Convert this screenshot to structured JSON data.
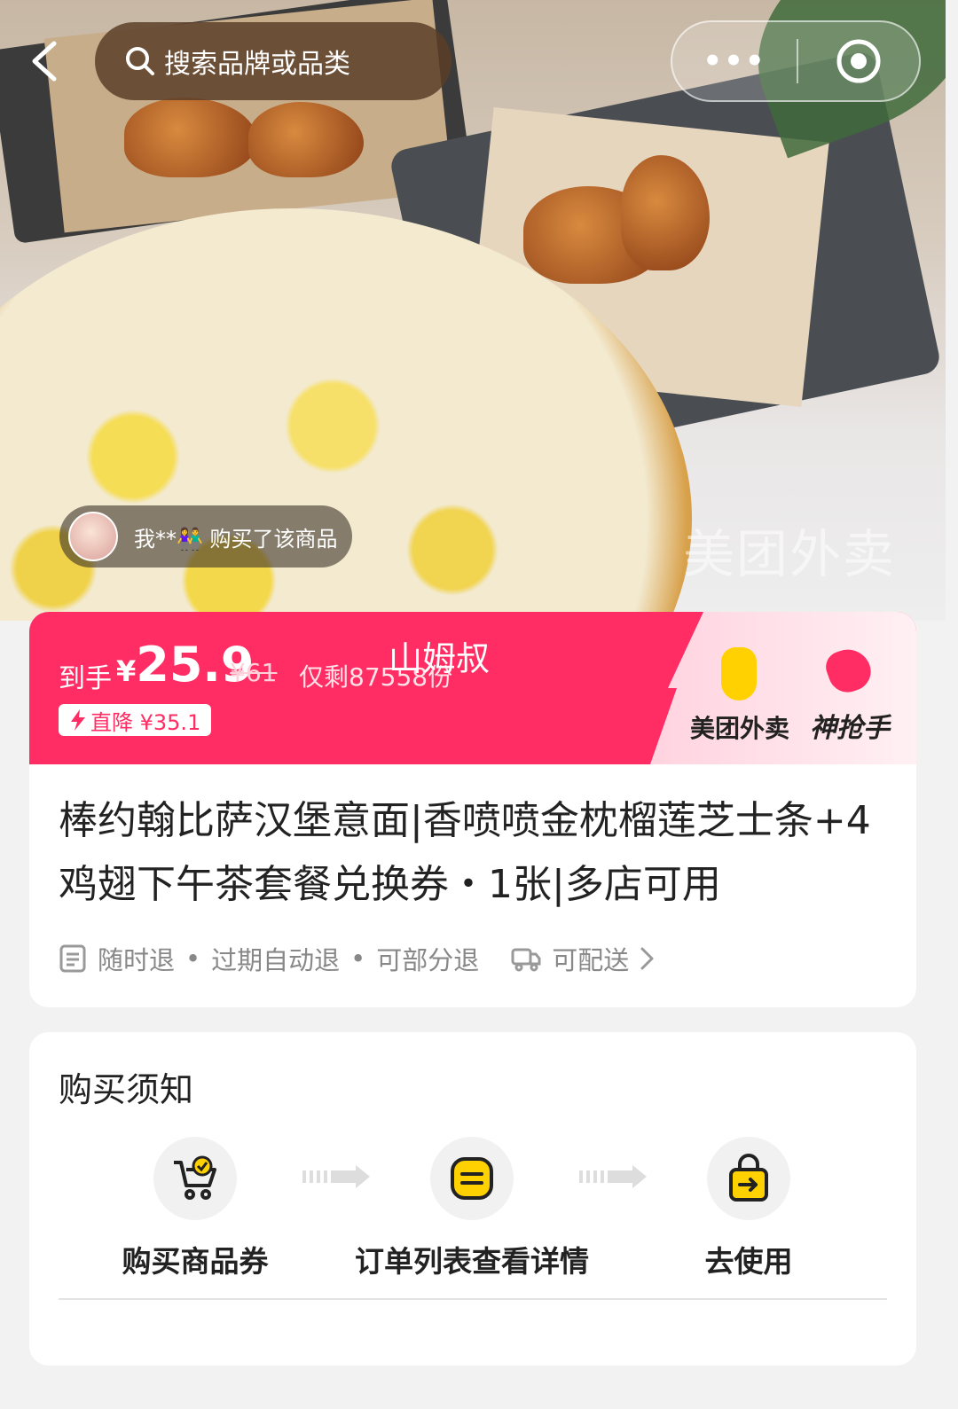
{
  "topbar": {
    "search_placeholder": "搜索品牌或品类",
    "more_label": "•••"
  },
  "hero": {
    "buyer_notice": "我**👫 购买了该商品",
    "watermark": "美团外卖"
  },
  "price": {
    "label": "到手",
    "currency": "¥",
    "current": "25.9",
    "original": "¥61",
    "stock": "仅剩87558份",
    "shop_overlay": "山姆叔",
    "drop_badge": "直降 ¥35.1",
    "brand_name": "美团外卖",
    "brand_tag": "神抢手",
    "accent_color": "#ff2d63"
  },
  "product": {
    "title": "棒约翰比萨汉堡意面|香喷喷金枕榴莲芝士条+4鸡翅下午茶套餐兑换券・1张|多店可用",
    "policy_1": "随时退",
    "policy_2": "过期自动退",
    "policy_3": "可部分退",
    "delivery": "可配送",
    "dot": "•"
  },
  "notice": {
    "title": "购买须知",
    "steps": [
      {
        "label": "购买商品券",
        "icon": "cart-check-icon"
      },
      {
        "label": "订单列表查看详情",
        "icon": "order-list-icon"
      },
      {
        "label": "去使用",
        "icon": "bag-use-icon"
      }
    ]
  }
}
